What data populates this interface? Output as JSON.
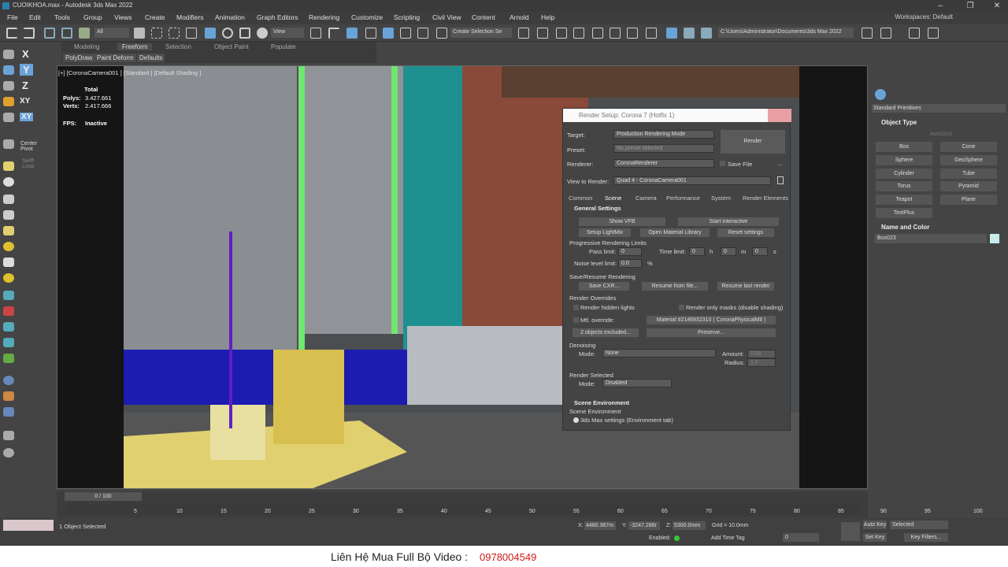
{
  "window": {
    "title": "CUOIKHOA.max - Autodesk 3ds Max 2022",
    "minimize": "–",
    "restore": "❐",
    "close": "✕"
  },
  "menu": [
    "File",
    "Edit",
    "Tools",
    "Group",
    "Views",
    "Create",
    "Modifiers",
    "Animation",
    "Graph Editors",
    "Rendering",
    "Customize",
    "Scripting",
    "Civil View",
    "Content",
    "Arnold",
    "Help"
  ],
  "workspaces": "Workspaces: Default",
  "toolbar": {
    "filter": "All",
    "view": "View",
    "selection_set": "Create Selection Se",
    "path": "C:\\Users\\Administrator\\Documents\\3ds Max 2022"
  },
  "ribbon": {
    "tabs": [
      "Modeling",
      "Freeform",
      "Selection",
      "Object Paint",
      "Populate"
    ],
    "subtabs": [
      "PolyDraw",
      "Paint Deform",
      "Defaults"
    ]
  },
  "left_toolbar": {
    "center_pivot": "Center Pivot",
    "swift_loop": "Swift Loop",
    "axes": [
      "X",
      "Y",
      "Z",
      "XY",
      "XY"
    ]
  },
  "viewport": {
    "label": "[+] [CoronaCamera001 ] [Standard ] [Default Shading ]",
    "total": "Total",
    "polys_label": "Polys:",
    "polys": "3.427.661",
    "verts_label": "Verts:",
    "verts": "2.417.666",
    "fps_label": "FPS:",
    "fps": "Inactive"
  },
  "command_panel": {
    "category": "Standard Primitives",
    "object_type": "Object Type",
    "autogrid": "AutoGrid",
    "buttons": [
      "Box",
      "Cone",
      "Sphere",
      "GeoSphere",
      "Cylinder",
      "Tube",
      "Torus",
      "Pyramid",
      "Teapot",
      "Plane",
      "TextPlus"
    ],
    "name_color": "Name and Color",
    "object_name": "Box023",
    "object_color": "#c8ecec"
  },
  "dialog": {
    "title": "Render Setup: Corona 7 (Hotfix 1)",
    "target_label": "Target:",
    "target": "Production Rendering Mode",
    "preset_label": "Preset:",
    "preset": "No preset selected",
    "renderer_label": "Renderer:",
    "renderer": "CoronaRenderer",
    "save_file": "Save File",
    "render_btn": "Render",
    "ellipsis": "...",
    "view_label": "View to Render:",
    "view": "Quad 4 - CoronaCamera001",
    "tabs": [
      "Common",
      "Scene",
      "Camera",
      "Performance",
      "System",
      "Render Elements"
    ],
    "general": "General Settings",
    "show_vfb": "Show VFB",
    "start_interactive": "Start interactive",
    "setup_lightmix": "Setup LightMix",
    "open_material_library": "Open Material Library",
    "reset_settings": "Reset settings",
    "progressive": "Progressive Rendering Limits",
    "pass_limit_label": "Pass limit:",
    "pass_limit": "0",
    "time_limit_label": "Time limit:",
    "time_h": "0",
    "time_m": "0",
    "time_s": "0",
    "h": "h",
    "m": "m",
    "s": "s",
    "noise_label": "Noise level limit:",
    "noise": "0.0",
    "pct": "%",
    "save_resume": "Save/Resume Rendering",
    "save_cxr": "Save CXR...",
    "resume_file": "Resume from file...",
    "resume_last": "Resume last render",
    "overrides": "Render Overrides",
    "hidden_lights": "Render hidden lights",
    "only_masks": "Render only masks (disable shading)",
    "mtl_override": "Mtl. override:",
    "material": "Material #2146932310 ( CoronaPhysicalMtl )",
    "excluded": "2 objects excluded...",
    "preserve": "Preserve...",
    "denoising": "Denoising",
    "mode_label": "Mode:",
    "denoise_mode": "None",
    "amount_label": "Amount:",
    "amount": "0.65",
    "radius_label": "Radius:",
    "radius": "1.0",
    "render_selected": "Render Selected",
    "rs_mode": "Disabled",
    "scene_env": "Scene Environment",
    "scene_env_sub": "Scene Environment",
    "env_opt": "3ds Max settings (Environment tab)"
  },
  "timeline": {
    "frame": "0 / 100",
    "ticks": [
      "5",
      "10",
      "15",
      "20",
      "25",
      "30",
      "35",
      "40",
      "45",
      "50",
      "55",
      "60",
      "65",
      "70",
      "75",
      "80",
      "85",
      "90",
      "95",
      "100"
    ]
  },
  "status": {
    "selected": "1 Object Selected",
    "x_label": "X:",
    "x": "4480.367m",
    "y_label": "Y:",
    "y": "-3247.288r",
    "z_label": "Z:",
    "z": "5300.0mm",
    "grid": "Grid = 10.0mm",
    "enabled": "Enabled:",
    "add_time_tag": "Add Time Tag",
    "auto_key": "Auto Key",
    "selected_dd": "Selected",
    "set_key": "Set Key",
    "key_filters": "Key Filters...",
    "frame_field": "0"
  },
  "footer": {
    "label": "Liên Hệ Mua Full Bộ Video :",
    "phone": "0978004549"
  }
}
